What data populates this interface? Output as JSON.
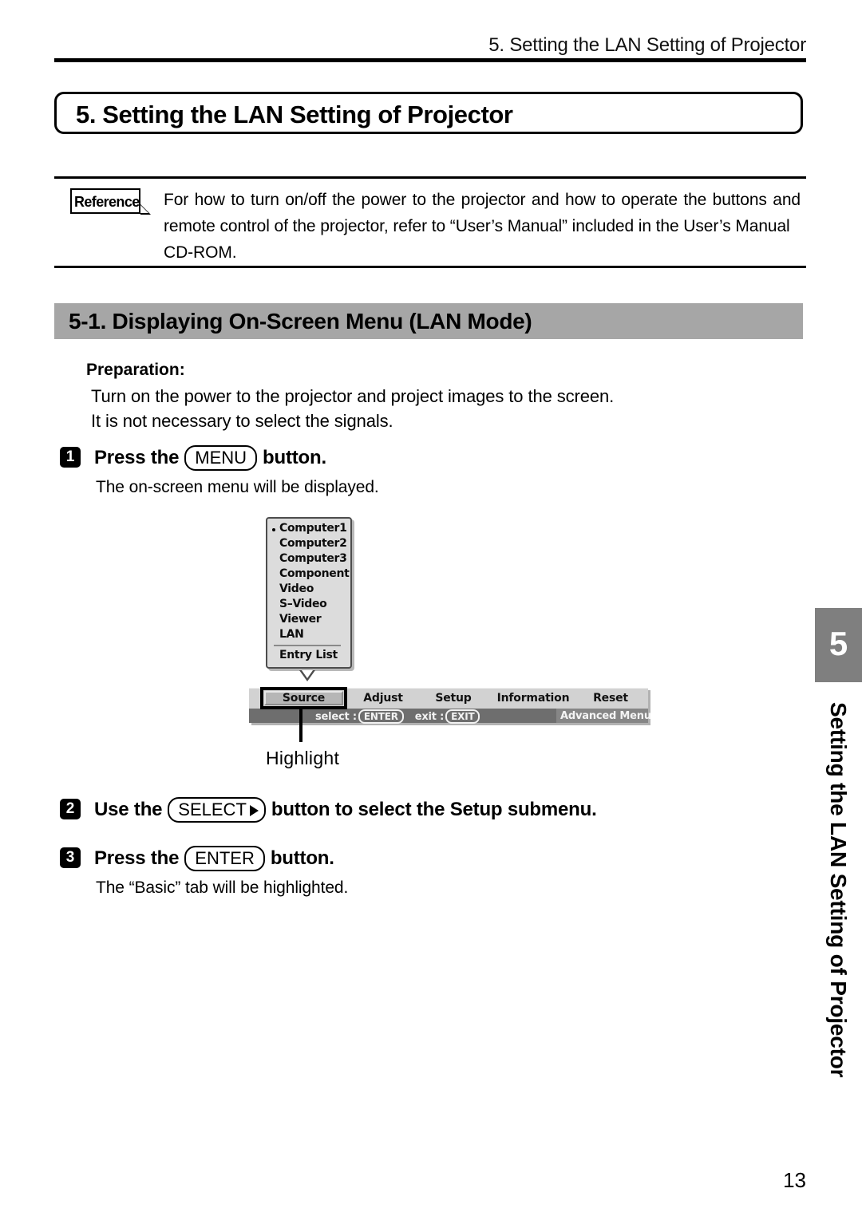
{
  "page": {
    "running_header": "5. Setting the LAN Setting of Projector",
    "page_number": "13"
  },
  "chapter": {
    "title": "5. Setting the LAN Setting of Projector"
  },
  "reference": {
    "tag_label": "Reference",
    "body": "For how to turn on/off the power to the projector and how to operate the buttons and remote control of the projector, refer to “User’s Manual” included in the User’s Manual",
    "body_last_line": "CD-ROM."
  },
  "section": {
    "title": "5-1.   Displaying On-Screen Menu (LAN Mode)",
    "bar_color": "#a6a6a6"
  },
  "preparation": {
    "label": "Preparation:",
    "line1": "Turn on the power to the projector and project images to the screen.",
    "line2": "It is not necessary to select the signals."
  },
  "steps": [
    {
      "number": "1",
      "text_before": "Press the",
      "key": "MENU",
      "text_after": "button.",
      "sub": "The on-screen menu will be displayed."
    },
    {
      "number": "2",
      "text_before": "Use the",
      "key": "SELECT",
      "key_has_arrow": true,
      "text_after": "button to select the Setup submenu.",
      "sub": ""
    },
    {
      "number": "3",
      "text_before": "Press the",
      "key": "ENTER",
      "text_after": "button.",
      "sub": "The “Basic” tab will be highlighted."
    }
  ],
  "osd": {
    "source_list": [
      "Computer1",
      "Computer2",
      "Computer3",
      "Component",
      "Video",
      "S–Video",
      "Viewer",
      "LAN"
    ],
    "entry_list_label": "Entry List",
    "selected_source_index": 0,
    "menu_tabs": [
      "Source",
      "Adjust",
      "Setup",
      "Information",
      "Reset"
    ],
    "selected_tab": "Source",
    "status": {
      "select_label": "select :",
      "select_key": "ENTER",
      "exit_label": "exit :",
      "exit_key": "EXIT",
      "advanced_menu": "Advanced Menu"
    },
    "caption": "Highlight"
  },
  "thumb_tab": {
    "number": "5",
    "text": "Setting the LAN Setting of Projector",
    "color": "#7f7f7f"
  }
}
